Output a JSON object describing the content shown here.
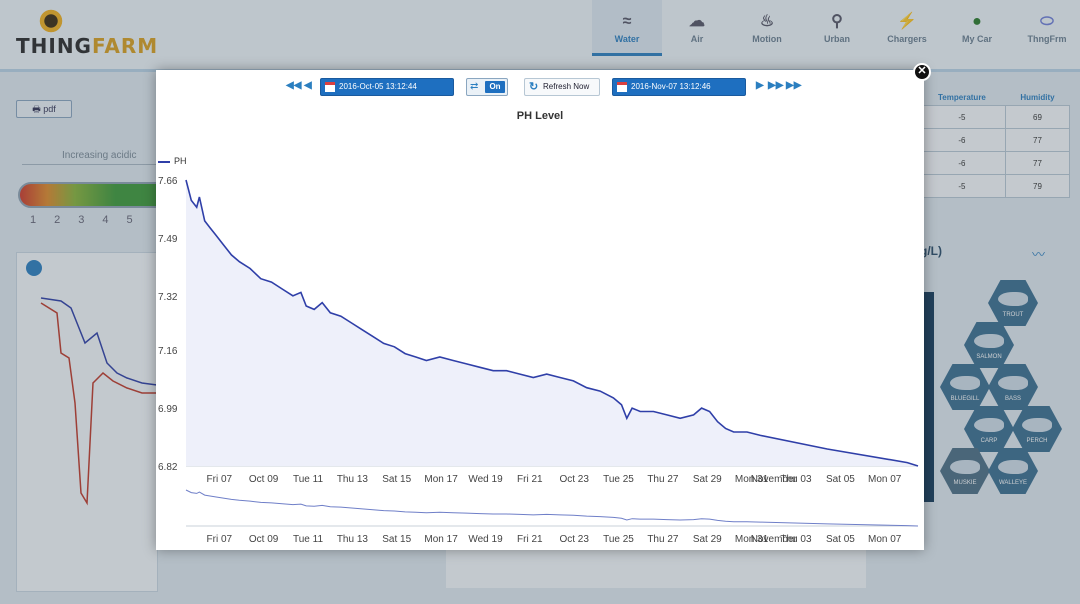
{
  "app": {
    "logo_text_a": "THING",
    "logo_text_b": "FARM"
  },
  "nav": [
    {
      "label": "Water",
      "icon": "fish-icon",
      "glyph": "≈",
      "active": true
    },
    {
      "label": "Air",
      "icon": "cloud-icon",
      "glyph": "☁",
      "active": false
    },
    {
      "label": "Motion",
      "icon": "motion-sensor-icon",
      "glyph": "♨",
      "active": false
    },
    {
      "label": "Urban",
      "icon": "antenna-icon",
      "glyph": "⚲",
      "active": false
    },
    {
      "label": "Chargers",
      "icon": "plug-icon",
      "glyph": "⚡",
      "active": false
    },
    {
      "label": "My Car",
      "icon": "car-pin-icon",
      "glyph": "●",
      "active": false
    },
    {
      "label": "ThngFrm",
      "icon": "device-icon",
      "glyph": "⬭",
      "active": false
    }
  ],
  "background": {
    "pdf_label": "pdf",
    "acid_label": "Increasing acidic",
    "ph_scale_numbers": [
      "1",
      "2",
      "3",
      "4",
      "5"
    ],
    "table_headers": [
      "Temperature",
      "Humidity"
    ],
    "table_rows": [
      [
        "-5",
        "69"
      ],
      [
        "-6",
        "77"
      ],
      [
        "-6",
        "77"
      ],
      [
        "-5",
        "79"
      ]
    ],
    "unit_label": "g/L)",
    "fish": [
      {
        "name": "TROUT",
        "n": "3"
      },
      {
        "name": "SALMON",
        "n": "5"
      },
      {
        "name": "BLUEGILL",
        "n": "5"
      },
      {
        "name": "BASS",
        "n": "5"
      },
      {
        "name": "CARP",
        "n": "5"
      },
      {
        "name": "PERCH",
        "n": "5"
      },
      {
        "name": "MUSKIE",
        "n": "5"
      },
      {
        "name": "WALLEYE",
        "n": "5"
      }
    ]
  },
  "modal": {
    "start_date": "2016-Oct-05 13:12:44",
    "end_date": "2016-Nov-07 13:12:46",
    "live_label": "On",
    "refresh_label": "Refresh Now",
    "close_glyph": "✕"
  },
  "chart_data": {
    "type": "area",
    "title": "PH Level",
    "legend_position": "top-left",
    "series": [
      {
        "name": "PH",
        "color": "#2f3fa8",
        "points": [
          [
            0.0,
            7.66
          ],
          [
            0.2,
            7.6
          ],
          [
            0.4,
            7.58
          ],
          [
            0.5,
            7.61
          ],
          [
            0.7,
            7.54
          ],
          [
            0.9,
            7.52
          ],
          [
            1.1,
            7.5
          ],
          [
            1.4,
            7.47
          ],
          [
            1.7,
            7.44
          ],
          [
            2.0,
            7.42
          ],
          [
            2.4,
            7.4
          ],
          [
            2.8,
            7.37
          ],
          [
            3.2,
            7.36
          ],
          [
            3.6,
            7.34
          ],
          [
            4.0,
            7.32
          ],
          [
            4.3,
            7.33
          ],
          [
            4.5,
            7.29
          ],
          [
            4.8,
            7.28
          ],
          [
            5.1,
            7.3
          ],
          [
            5.4,
            7.27
          ],
          [
            5.8,
            7.26
          ],
          [
            6.2,
            7.24
          ],
          [
            6.6,
            7.22
          ],
          [
            7.0,
            7.2
          ],
          [
            7.4,
            7.18
          ],
          [
            7.8,
            7.17
          ],
          [
            8.2,
            7.15
          ],
          [
            8.6,
            7.14
          ],
          [
            9.0,
            7.13
          ],
          [
            9.5,
            7.14
          ],
          [
            10.0,
            7.13
          ],
          [
            10.5,
            7.12
          ],
          [
            11.0,
            7.11
          ],
          [
            11.5,
            7.1
          ],
          [
            12.0,
            7.1
          ],
          [
            12.5,
            7.09
          ],
          [
            13.0,
            7.08
          ],
          [
            13.5,
            7.09
          ],
          [
            14.0,
            7.08
          ],
          [
            14.5,
            7.07
          ],
          [
            15.0,
            7.05
          ],
          [
            15.5,
            7.04
          ],
          [
            16.0,
            7.02
          ],
          [
            16.3,
            7.0
          ],
          [
            16.5,
            6.96
          ],
          [
            16.7,
            6.99
          ],
          [
            17.0,
            6.98
          ],
          [
            17.5,
            6.98
          ],
          [
            18.0,
            6.97
          ],
          [
            18.5,
            6.96
          ],
          [
            19.0,
            6.97
          ],
          [
            19.3,
            6.99
          ],
          [
            19.6,
            6.98
          ],
          [
            19.9,
            6.95
          ],
          [
            20.2,
            6.93
          ],
          [
            20.5,
            6.92
          ],
          [
            21.0,
            6.92
          ],
          [
            21.5,
            6.91
          ],
          [
            24.0,
            6.87
          ],
          [
            27.0,
            6.83
          ],
          [
            27.4,
            6.82
          ]
        ]
      }
    ],
    "x_range": [
      "2016-10-05 13:12:44",
      "2016-11-07 13:12:46"
    ],
    "x_tick_labels": [
      "Fri 07",
      "Oct 09",
      "Tue 11",
      "Thu 13",
      "Sat 15",
      "Mon 17",
      "Wed 19",
      "Fri 21",
      "Oct 23",
      "Tue 25",
      "Thu 27",
      "Sat 29",
      "Mon 31",
      "November",
      "Thu 03",
      "Sat 05",
      "Mon 07"
    ],
    "x_tick_values": [
      1.5,
      3.5,
      5.5,
      7.5,
      9.5,
      11.5,
      13.5,
      15.5,
      17.5,
      19.5,
      21.5,
      23.5,
      25.5,
      26.5,
      27.5,
      29.5,
      31.5
    ],
    "y_tick_labels": [
      "7.66",
      "7.49",
      "7.32",
      "7.16",
      "6.99",
      "6.82"
    ],
    "ylim": [
      6.82,
      7.66
    ],
    "grid": false,
    "navigator": true
  }
}
